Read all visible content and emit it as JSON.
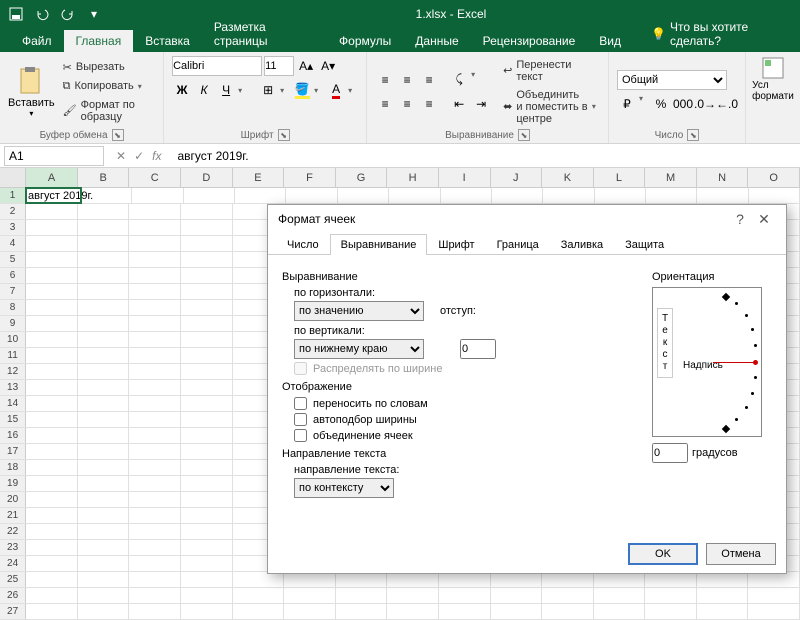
{
  "titlebar": {
    "title": "1.xlsx - Excel"
  },
  "ribbon_tabs": {
    "file": "Файл",
    "home": "Главная",
    "insert": "Вставка",
    "layout": "Разметка страницы",
    "formulas": "Формулы",
    "data": "Данные",
    "review": "Рецензирование",
    "view": "Вид",
    "tellme": "Что вы хотите сделать?"
  },
  "ribbon": {
    "clipboard": {
      "paste": "Вставить",
      "cut": "Вырезать",
      "copy": "Копировать",
      "format_painter": "Формат по образцу",
      "group": "Буфер обмена"
    },
    "font": {
      "name": "Calibri",
      "size": "11",
      "bold": "Ж",
      "italic": "К",
      "underline": "Ч",
      "group": "Шрифт"
    },
    "alignment": {
      "wrap": "Перенести текст",
      "merge": "Объединить и поместить в центре",
      "group": "Выравнивание"
    },
    "number": {
      "format": "Общий",
      "group": "Число"
    },
    "styles": {
      "cond": "Усл формати"
    }
  },
  "formula_bar": {
    "name": "A1",
    "formula": "август 2019г."
  },
  "grid": {
    "cols": [
      "A",
      "B",
      "C",
      "D",
      "E",
      "F",
      "G",
      "H",
      "I",
      "J",
      "K",
      "L",
      "M",
      "N",
      "O"
    ],
    "a1": "август 2019г."
  },
  "dialog": {
    "title": "Формат ячеек",
    "tabs": {
      "number": "Число",
      "alignment": "Выравнивание",
      "font": "Шрифт",
      "border": "Граница",
      "fill": "Заливка",
      "protection": "Защита"
    },
    "align_section": "Выравнивание",
    "horiz_label": "по горизонтали:",
    "horiz_value": "по значению",
    "indent_label": "отступ:",
    "indent_value": "0",
    "vert_label": "по вертикали:",
    "vert_value": "по нижнему краю",
    "distribute": "Распределять по ширине",
    "display_section": "Отображение",
    "wrap": "переносить по словам",
    "autofit": "автоподбор ширины",
    "merge": "объединение ячеек",
    "direction_section": "Направление текста",
    "direction_label": "направление текста:",
    "direction_value": "по контексту",
    "orientation": "Ориентация",
    "orient_vert": "Текст",
    "orient_label": "Надпись",
    "degrees": "0",
    "degrees_label": "градусов",
    "ok": "OK",
    "cancel": "Отмена"
  }
}
